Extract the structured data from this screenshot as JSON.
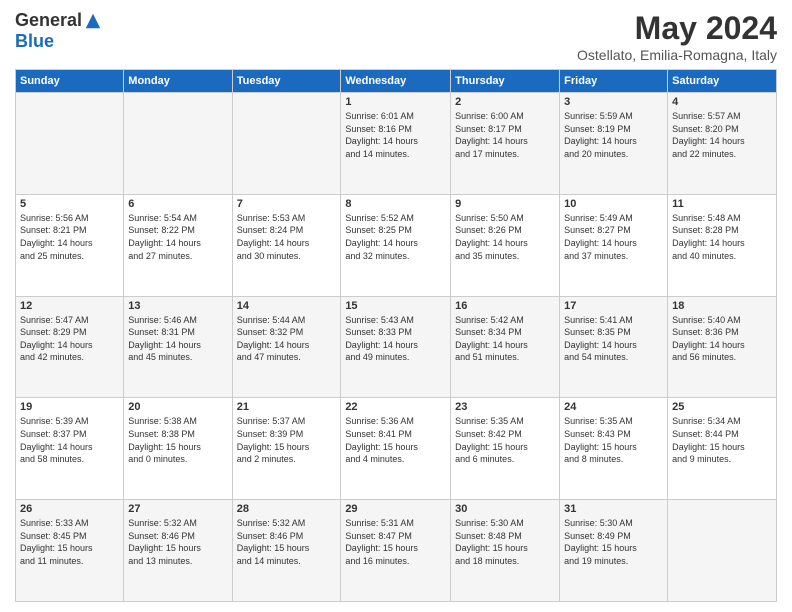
{
  "header": {
    "logo_general": "General",
    "logo_blue": "Blue",
    "title": "May 2024",
    "location": "Ostellato, Emilia-Romagna, Italy"
  },
  "days_of_week": [
    "Sunday",
    "Monday",
    "Tuesday",
    "Wednesday",
    "Thursday",
    "Friday",
    "Saturday"
  ],
  "weeks": [
    [
      {
        "day": "",
        "info": ""
      },
      {
        "day": "",
        "info": ""
      },
      {
        "day": "",
        "info": ""
      },
      {
        "day": "1",
        "info": "Sunrise: 6:01 AM\nSunset: 8:16 PM\nDaylight: 14 hours\nand 14 minutes."
      },
      {
        "day": "2",
        "info": "Sunrise: 6:00 AM\nSunset: 8:17 PM\nDaylight: 14 hours\nand 17 minutes."
      },
      {
        "day": "3",
        "info": "Sunrise: 5:59 AM\nSunset: 8:19 PM\nDaylight: 14 hours\nand 20 minutes."
      },
      {
        "day": "4",
        "info": "Sunrise: 5:57 AM\nSunset: 8:20 PM\nDaylight: 14 hours\nand 22 minutes."
      }
    ],
    [
      {
        "day": "5",
        "info": "Sunrise: 5:56 AM\nSunset: 8:21 PM\nDaylight: 14 hours\nand 25 minutes."
      },
      {
        "day": "6",
        "info": "Sunrise: 5:54 AM\nSunset: 8:22 PM\nDaylight: 14 hours\nand 27 minutes."
      },
      {
        "day": "7",
        "info": "Sunrise: 5:53 AM\nSunset: 8:24 PM\nDaylight: 14 hours\nand 30 minutes."
      },
      {
        "day": "8",
        "info": "Sunrise: 5:52 AM\nSunset: 8:25 PM\nDaylight: 14 hours\nand 32 minutes."
      },
      {
        "day": "9",
        "info": "Sunrise: 5:50 AM\nSunset: 8:26 PM\nDaylight: 14 hours\nand 35 minutes."
      },
      {
        "day": "10",
        "info": "Sunrise: 5:49 AM\nSunset: 8:27 PM\nDaylight: 14 hours\nand 37 minutes."
      },
      {
        "day": "11",
        "info": "Sunrise: 5:48 AM\nSunset: 8:28 PM\nDaylight: 14 hours\nand 40 minutes."
      }
    ],
    [
      {
        "day": "12",
        "info": "Sunrise: 5:47 AM\nSunset: 8:29 PM\nDaylight: 14 hours\nand 42 minutes."
      },
      {
        "day": "13",
        "info": "Sunrise: 5:46 AM\nSunset: 8:31 PM\nDaylight: 14 hours\nand 45 minutes."
      },
      {
        "day": "14",
        "info": "Sunrise: 5:44 AM\nSunset: 8:32 PM\nDaylight: 14 hours\nand 47 minutes."
      },
      {
        "day": "15",
        "info": "Sunrise: 5:43 AM\nSunset: 8:33 PM\nDaylight: 14 hours\nand 49 minutes."
      },
      {
        "day": "16",
        "info": "Sunrise: 5:42 AM\nSunset: 8:34 PM\nDaylight: 14 hours\nand 51 minutes."
      },
      {
        "day": "17",
        "info": "Sunrise: 5:41 AM\nSunset: 8:35 PM\nDaylight: 14 hours\nand 54 minutes."
      },
      {
        "day": "18",
        "info": "Sunrise: 5:40 AM\nSunset: 8:36 PM\nDaylight: 14 hours\nand 56 minutes."
      }
    ],
    [
      {
        "day": "19",
        "info": "Sunrise: 5:39 AM\nSunset: 8:37 PM\nDaylight: 14 hours\nand 58 minutes."
      },
      {
        "day": "20",
        "info": "Sunrise: 5:38 AM\nSunset: 8:38 PM\nDaylight: 15 hours\nand 0 minutes."
      },
      {
        "day": "21",
        "info": "Sunrise: 5:37 AM\nSunset: 8:39 PM\nDaylight: 15 hours\nand 2 minutes."
      },
      {
        "day": "22",
        "info": "Sunrise: 5:36 AM\nSunset: 8:41 PM\nDaylight: 15 hours\nand 4 minutes."
      },
      {
        "day": "23",
        "info": "Sunrise: 5:35 AM\nSunset: 8:42 PM\nDaylight: 15 hours\nand 6 minutes."
      },
      {
        "day": "24",
        "info": "Sunrise: 5:35 AM\nSunset: 8:43 PM\nDaylight: 15 hours\nand 8 minutes."
      },
      {
        "day": "25",
        "info": "Sunrise: 5:34 AM\nSunset: 8:44 PM\nDaylight: 15 hours\nand 9 minutes."
      }
    ],
    [
      {
        "day": "26",
        "info": "Sunrise: 5:33 AM\nSunset: 8:45 PM\nDaylight: 15 hours\nand 11 minutes."
      },
      {
        "day": "27",
        "info": "Sunrise: 5:32 AM\nSunset: 8:46 PM\nDaylight: 15 hours\nand 13 minutes."
      },
      {
        "day": "28",
        "info": "Sunrise: 5:32 AM\nSunset: 8:46 PM\nDaylight: 15 hours\nand 14 minutes."
      },
      {
        "day": "29",
        "info": "Sunrise: 5:31 AM\nSunset: 8:47 PM\nDaylight: 15 hours\nand 16 minutes."
      },
      {
        "day": "30",
        "info": "Sunrise: 5:30 AM\nSunset: 8:48 PM\nDaylight: 15 hours\nand 18 minutes."
      },
      {
        "day": "31",
        "info": "Sunrise: 5:30 AM\nSunset: 8:49 PM\nDaylight: 15 hours\nand 19 minutes."
      },
      {
        "day": "",
        "info": ""
      }
    ]
  ]
}
